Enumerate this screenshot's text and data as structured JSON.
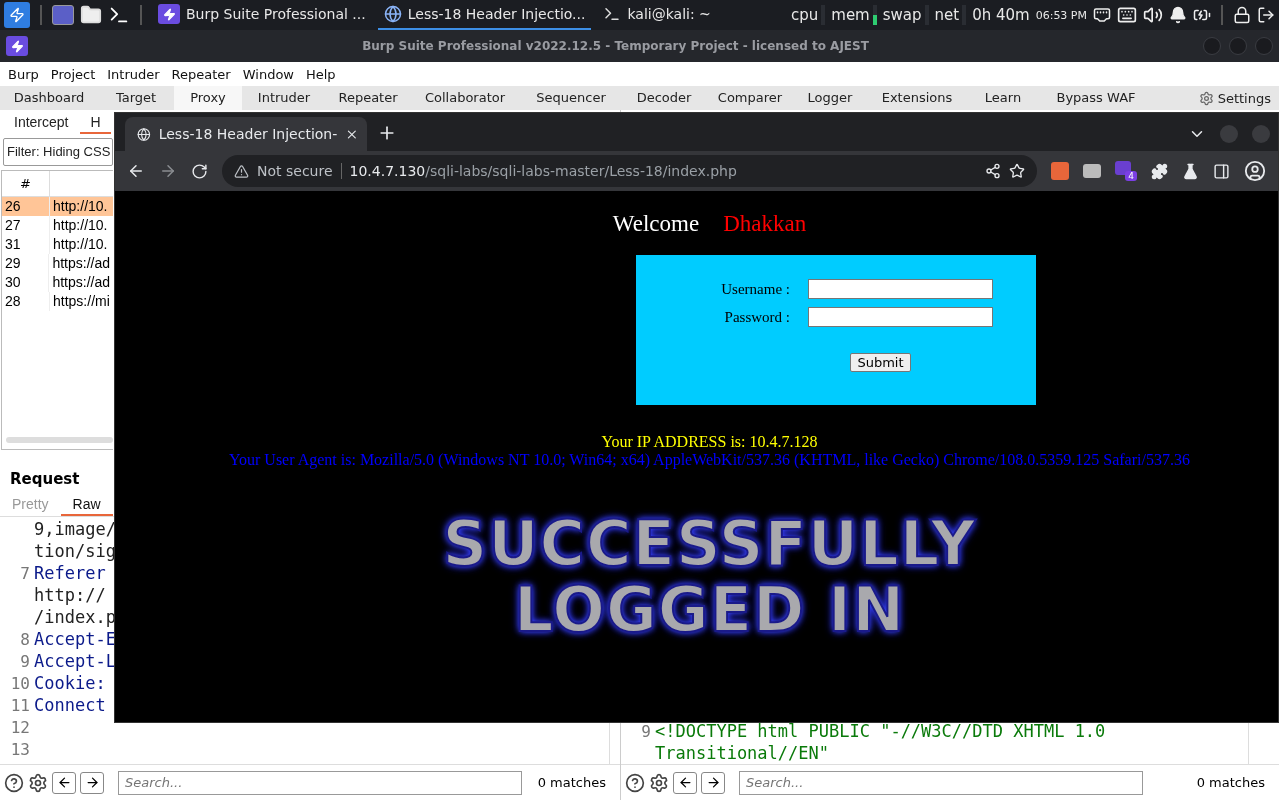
{
  "taskbar": {
    "tasks": [
      {
        "label": "Burp Suite Professional ...",
        "selected": false,
        "kind": "burp"
      },
      {
        "label": "Less-18 Header Injectio...",
        "selected": true,
        "kind": "browser"
      },
      {
        "label": "kali@kali: ~",
        "selected": false,
        "kind": "terminal"
      }
    ],
    "monitors": [
      {
        "label": "cpu"
      },
      {
        "label": "mem",
        "level": 0.5
      },
      {
        "label": "swap"
      },
      {
        "label": "net"
      }
    ],
    "uptime": "0h 40m",
    "clock": "06:53 PM"
  },
  "burp": {
    "title": "Burp Suite Professional v2022.12.5 - Temporary Project - licensed to AJEST",
    "menu": [
      "Burp",
      "Project",
      "Intruder",
      "Repeater",
      "Window",
      "Help"
    ],
    "tabs": [
      {
        "label": "Dashboard",
        "selected": false
      },
      {
        "label": "Target",
        "selected": false
      },
      {
        "label": "Proxy",
        "selected": true
      },
      {
        "label": "Intruder",
        "selected": false
      },
      {
        "label": "Repeater",
        "selected": false
      },
      {
        "label": "Collaborator",
        "selected": false
      },
      {
        "label": "Sequencer",
        "selected": false
      },
      {
        "label": "Decoder",
        "selected": false
      },
      {
        "label": "Comparer",
        "selected": false
      },
      {
        "label": "Logger",
        "selected": false
      },
      {
        "label": "Extensions",
        "selected": false
      },
      {
        "label": "Learn",
        "selected": false
      },
      {
        "label": "Bypass WAF",
        "selected": false
      }
    ],
    "settings": "Settings",
    "subtabs": [
      {
        "label": "Intercept",
        "selected": false
      },
      {
        "label": "H",
        "selected": true
      }
    ],
    "filter": "Filter: Hiding CSS",
    "history": {
      "columns": [
        "#"
      ],
      "rows": [
        {
          "number": "26",
          "url": "http://10.",
          "selected": true
        },
        {
          "number": "27",
          "url": "http://10.",
          "selected": false
        },
        {
          "number": "31",
          "url": "http://10.",
          "selected": false
        },
        {
          "number": "29",
          "url": "https://ad",
          "selected": false
        },
        {
          "number": "30",
          "url": "https://ad",
          "selected": false
        },
        {
          "number": "28",
          "url": "https://mi",
          "selected": false
        }
      ]
    },
    "request": {
      "title": "Request",
      "views": [
        {
          "label": "Pretty",
          "selected": false
        },
        {
          "label": "Raw",
          "selected": true
        }
      ],
      "lines": [
        {
          "text": "9,image/",
          "kind": "value"
        },
        {
          "text": "tion/sig",
          "kind": "value"
        },
        {
          "number": "7",
          "text": "Referer",
          "kind": "header"
        },
        {
          "text": "http://",
          "kind": "value"
        },
        {
          "text": "/index.p",
          "kind": "value"
        },
        {
          "number": "8",
          "text": "Accept-E",
          "kind": "header"
        },
        {
          "number": "9",
          "text": "Accept-L",
          "kind": "header"
        },
        {
          "number": "10",
          "text": "Cookie:",
          "kind": "header"
        },
        {
          "number": "11",
          "text": "Connect",
          "kind": "header"
        },
        {
          "number": "12"
        },
        {
          "number": "13"
        }
      ]
    },
    "response": {
      "lines": [
        {
          "number": "9",
          "text": "<!DOCTYPE html PUBLIC \"-//W3C//DTD XHTML 1.0",
          "kind": "markup"
        },
        {
          "text": "Transitional//EN\"",
          "kind": "markup"
        }
      ]
    },
    "search_bars": [
      {
        "placeholder": "Search...",
        "matches": "0 matches"
      },
      {
        "placeholder": "Search...",
        "matches": "0 matches"
      }
    ]
  },
  "browser": {
    "tab": {
      "title": "Less-18 Header Injection-"
    },
    "security": "Not secure",
    "url_host": "10.4.7.130",
    "url_path": "/sqli-labs/sqli-labs-master/Less-18/index.php",
    "extension_badge": "4",
    "page": {
      "welcome": "Welcome",
      "name": "Dhakkan",
      "form": {
        "fields": [
          {
            "label": "Username :"
          },
          {
            "label": "Password :"
          }
        ],
        "submit": "Submit"
      },
      "ip": "Your IP ADDRESS is: 10.4.7.128",
      "user_agent": "Your User Agent is: Mozilla/5.0 (Windows NT 10.0; Win64; x64) AppleWebKit/537.36 (KHTML, like Gecko) Chrome/108.0.5359.125 Safari/537.36",
      "banner": [
        "SUCCESSFULLY",
        "LOGGED IN"
      ]
    }
  }
}
